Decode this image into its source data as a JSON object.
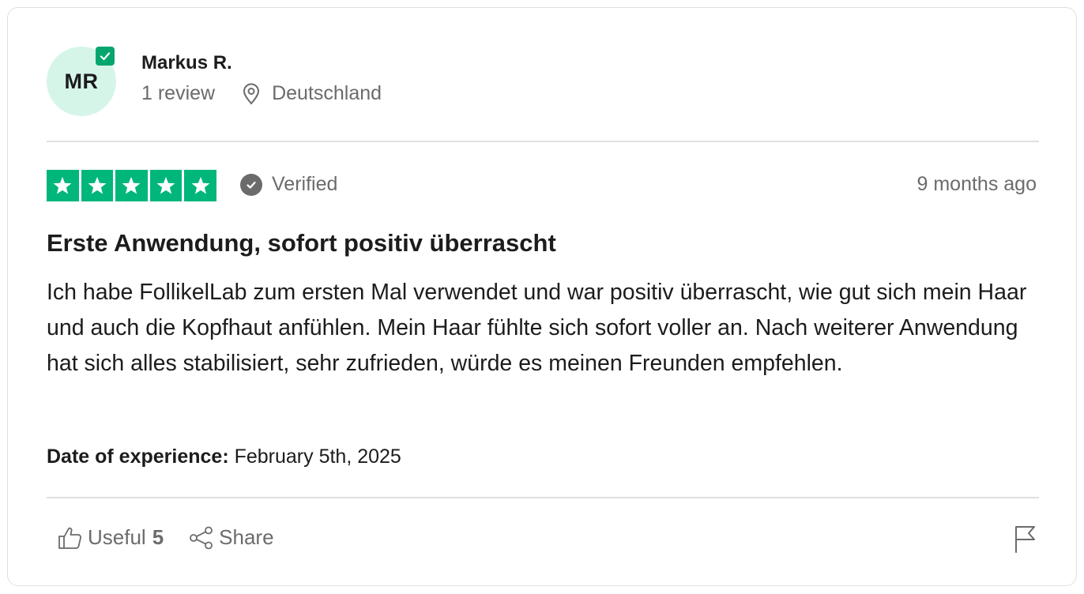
{
  "reviewer": {
    "initials": "MR",
    "name": "Markus R.",
    "review_count": "1 review",
    "location": "Deutschland",
    "avatar_bg": "#d6f5e9",
    "badge_color": "#04a66d"
  },
  "rating": {
    "stars": 5,
    "max_stars": 5,
    "star_color": "#00b67a"
  },
  "verified_label": "Verified",
  "posted_ago": "9 months ago",
  "review": {
    "title": "Erste Anwendung, sofort positiv überrascht",
    "body": "Ich habe FollikelLab zum ersten Mal verwendet und war positiv überrascht, wie gut sich mein Haar und auch die Kopfhaut anfühlen. Mein Haar fühlte sich sofort voller an. Nach weiterer Anwendung hat sich alles stabilisiert, sehr zufrieden, würde es meinen Freunden empfehlen."
  },
  "experience": {
    "label": "Date of experience:",
    "date": "February 5th, 2025"
  },
  "actions": {
    "useful_label": "Useful",
    "useful_count": "5",
    "share_label": "Share",
    "icons": [
      "thumbs-up-icon",
      "share-icon",
      "flag-icon"
    ]
  }
}
